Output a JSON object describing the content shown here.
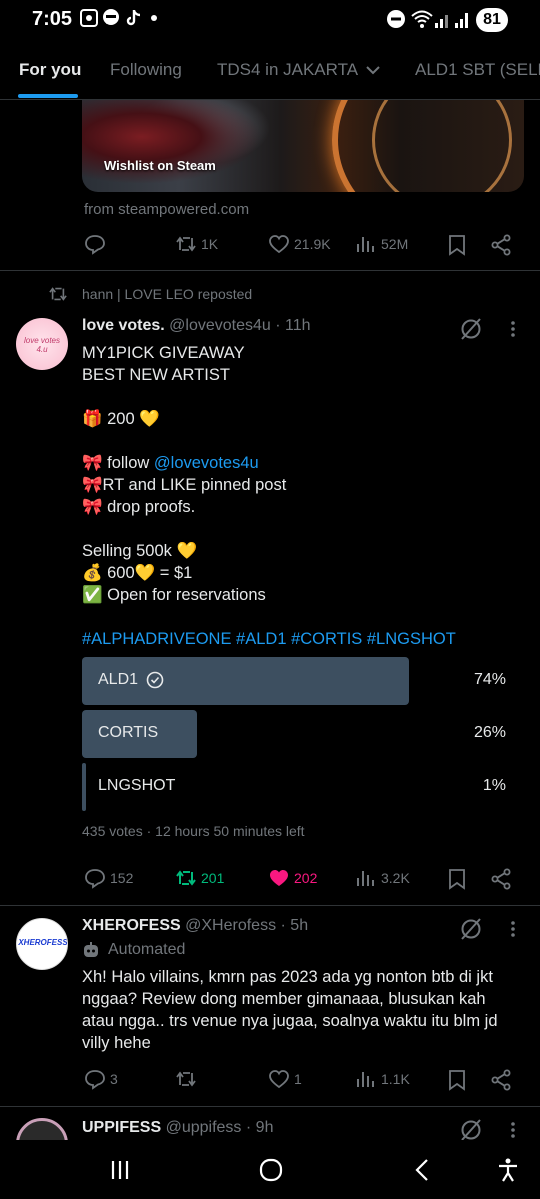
{
  "status_bar": {
    "time": "7:05",
    "battery": "81"
  },
  "tabs": [
    {
      "label": "For you"
    },
    {
      "label": "Following"
    },
    {
      "label": "TDS4 in JAKARTA"
    },
    {
      "label": "ALD1 SBT (SELL"
    }
  ],
  "post1": {
    "card_label": "Wishlist on Steam",
    "source": "from steampowered.com",
    "reposts": "1K",
    "likes": "21.9K",
    "views": "52M"
  },
  "post2": {
    "repost_by": "hann | LOVE LEO reposted",
    "name": "love votes.",
    "handle": "@lovevotes4u",
    "time": "· 11h",
    "avatar_text": "love votes 4.u",
    "lines": [
      "MY1PICK GIVEAWAY",
      "BEST NEW ARTIST",
      "🎁 200 💛",
      "🎀 follow ",
      "@lovevotes4u",
      "🎀RT and LIKE pinned post",
      "🎀 drop proofs.",
      "Selling 500k 💛",
      "💰 600💛 = $1",
      "✅ Open for reservations"
    ],
    "hashtags": "#ALPHADRIVEONE #ALD1 #CORTIS #LNGSHOT",
    "poll": [
      {
        "label": "ALD1",
        "pct": "74%",
        "value": 74
      },
      {
        "label": "CORTIS",
        "pct": "26%",
        "value": 26
      },
      {
        "label": "LNGSHOT",
        "pct": "1%",
        "value": 1
      }
    ],
    "poll_meta": "435 votes · 12 hours 50 minutes left",
    "replies": "152",
    "reposts": "201",
    "likes": "202",
    "views": "3.2K"
  },
  "post3": {
    "name": "XHEROFESS",
    "handle": "@XHerofess",
    "time": "· 5h",
    "avatar_text": "XHEROFESS",
    "automated": "Automated",
    "text": "Xh! Halo villains, kmrn pas 2023 ada yg nonton btb di jkt nggaa? Review dong member gimanaaa, blusukan kah atau ngga.. trs venue nya jugaa, soalnya waktu itu blm jd villy hehe",
    "replies": "3",
    "likes": "1",
    "views": "1.1K"
  },
  "post4": {
    "name": "UPPIFESS",
    "handle": "@uppifess",
    "time": "· 9h"
  },
  "colors": {
    "accent": "#1d9bf0",
    "repost_green": "#00ba7c",
    "like_pink": "#f91880",
    "poll_bar": "#3d4f60"
  }
}
